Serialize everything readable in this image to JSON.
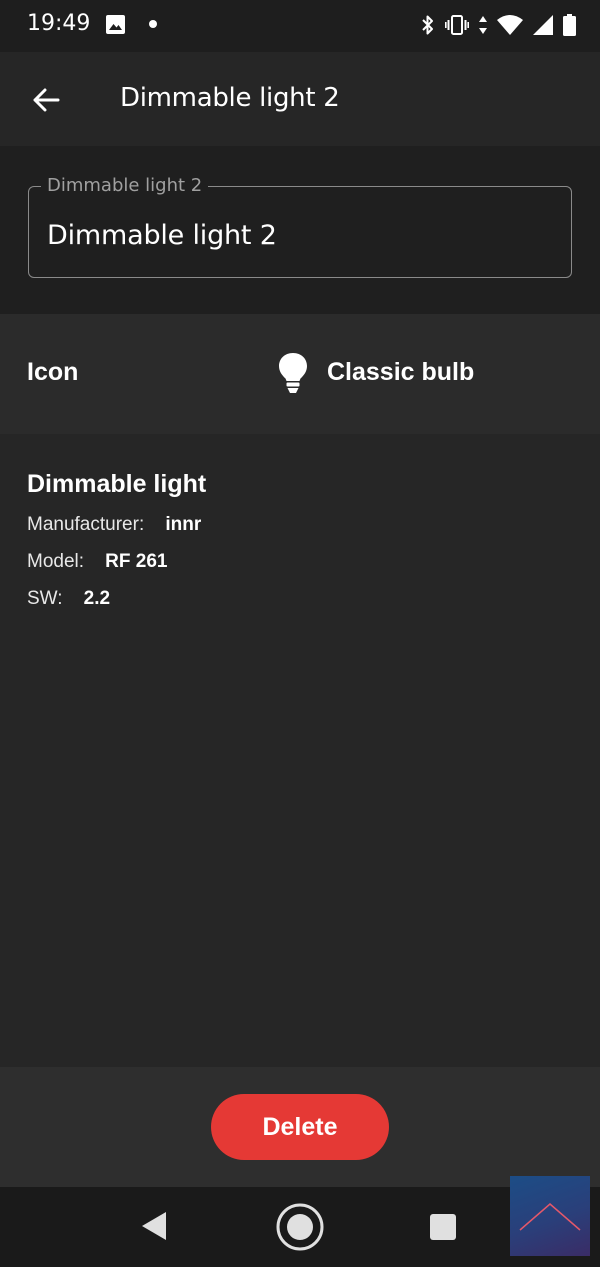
{
  "status_bar": {
    "time": "19:49",
    "icons": [
      "gallery-icon",
      "notification-dot-icon",
      "bluetooth-icon",
      "vibrate-icon",
      "data-arrows-icon",
      "wifi-icon",
      "cell-signal-icon",
      "battery-icon"
    ]
  },
  "app_bar": {
    "back_icon": "arrow-back-icon",
    "title": "Dimmable light 2"
  },
  "name_field": {
    "label": "Dimmable light 2",
    "value": "Dimmable light 2"
  },
  "icon_row": {
    "label": "Icon",
    "icon": "bulb-icon",
    "value": "Classic bulb"
  },
  "info": {
    "title": "Dimmable light",
    "manufacturer_label": "Manufacturer:",
    "manufacturer_value": "innr",
    "model_label": "Model:",
    "model_value": "RF 261",
    "sw_label": "SW:",
    "sw_value": "2.2"
  },
  "actions": {
    "delete_label": "Delete"
  },
  "nav_bar": {
    "icons": [
      "nav-back-icon",
      "nav-home-icon",
      "nav-recents-icon"
    ]
  },
  "colors": {
    "delete": "#e53935",
    "background": "#262626",
    "section_dark": "#1f1f1f",
    "icon_row_bg": "#2b2b2b"
  }
}
